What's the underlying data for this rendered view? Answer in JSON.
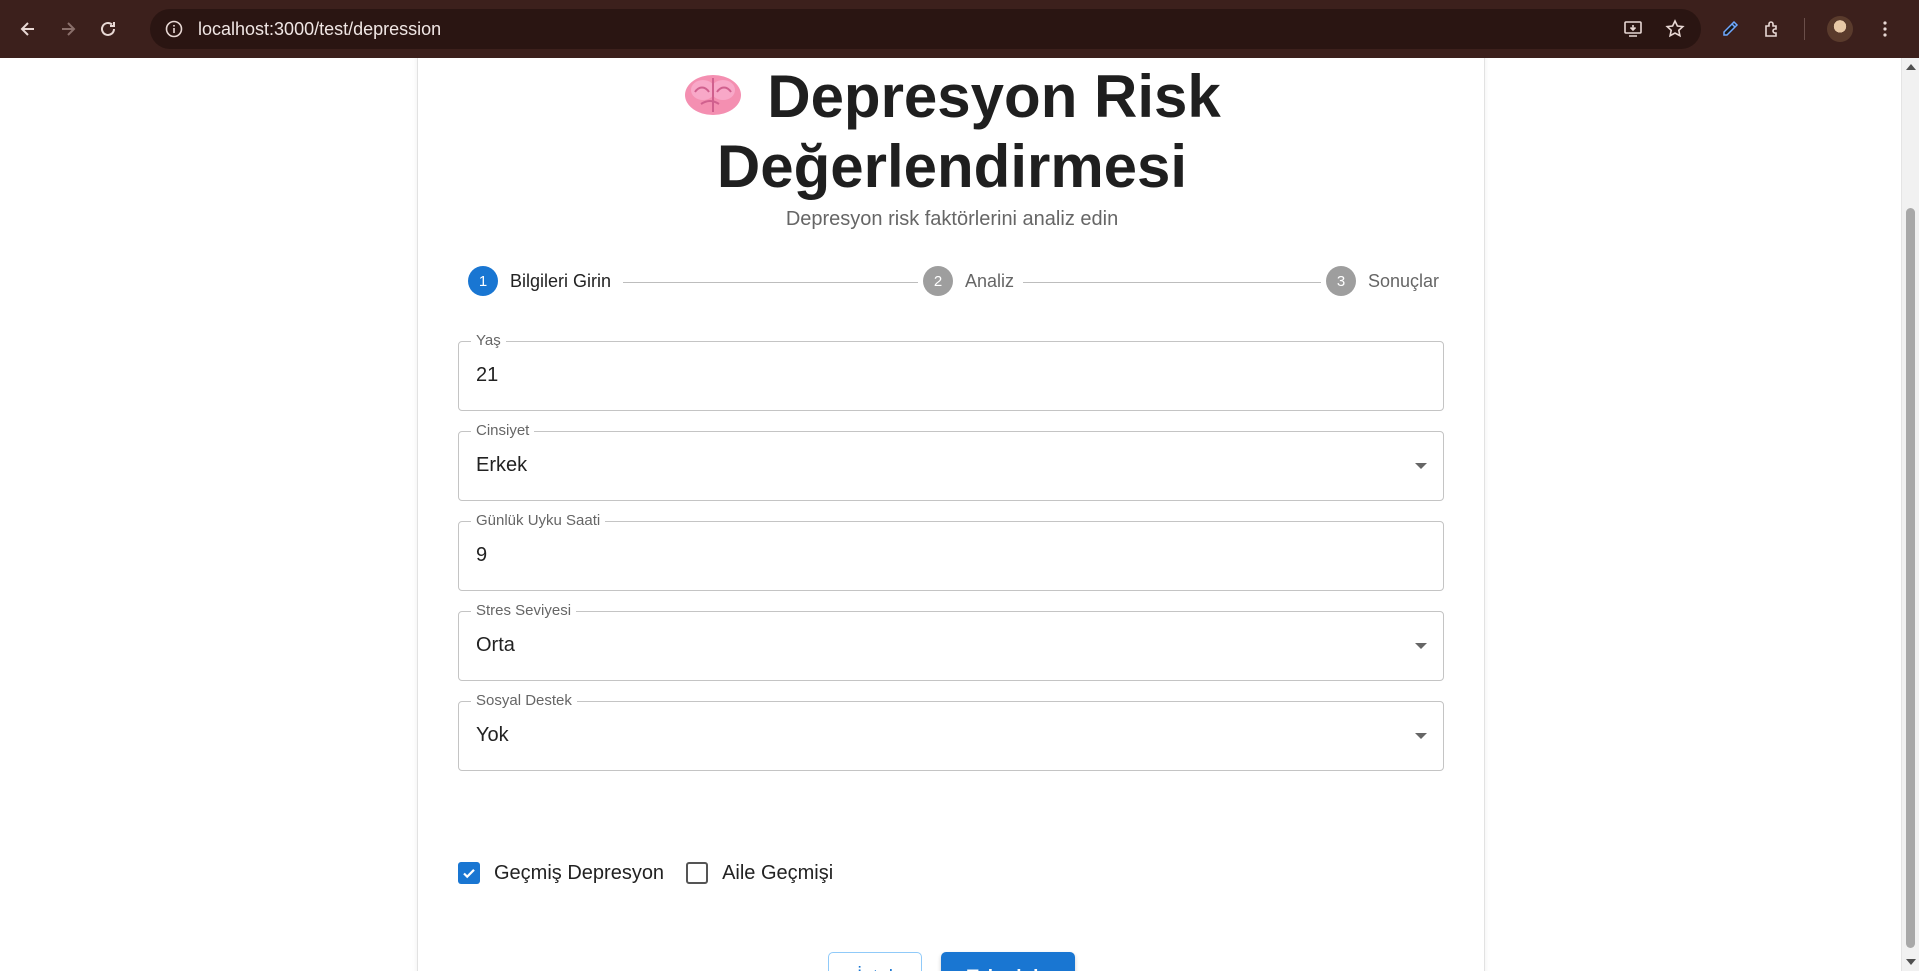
{
  "browser": {
    "url": "localhost:3000/test/depression"
  },
  "page": {
    "title_line1": "Depresyon Risk",
    "title_line2": "Değerlendirmesi",
    "subtitle": "Depresyon risk faktörlerini analiz edin"
  },
  "stepper": {
    "steps": [
      {
        "number": "1",
        "label": "Bilgileri Girin",
        "active": true
      },
      {
        "number": "2",
        "label": "Analiz",
        "active": false
      },
      {
        "number": "3",
        "label": "Sonuçlar",
        "active": false
      }
    ]
  },
  "form": {
    "age": {
      "label": "Yaş",
      "value": "21"
    },
    "gender": {
      "label": "Cinsiyet",
      "value": "Erkek"
    },
    "sleep": {
      "label": "Günlük Uyku Saati",
      "value": "9"
    },
    "stress": {
      "label": "Stres Seviyesi",
      "value": "Orta"
    },
    "social": {
      "label": "Sosyal Destek",
      "value": "Yok"
    },
    "past_depression": {
      "label": "Geçmiş Depresyon",
      "checked": true
    },
    "family_history": {
      "label": "Aile Geçmişi",
      "checked": false
    }
  },
  "actions": {
    "cancel_label": "İptal",
    "predict_label": "Tahminle"
  },
  "colors": {
    "primary": "#1976d2",
    "chrome": "#3c201c"
  },
  "icons": [
    "back-arrow-icon",
    "forward-arrow-icon",
    "reload-icon",
    "site-info-icon",
    "install-app-icon",
    "bookmark-star-icon",
    "eyedropper-icon",
    "extensions-icon",
    "profile-avatar-icon",
    "more-menu-icon",
    "brain-emoji-icon",
    "checkmark-icon",
    "dropdown-caret-icon"
  ]
}
